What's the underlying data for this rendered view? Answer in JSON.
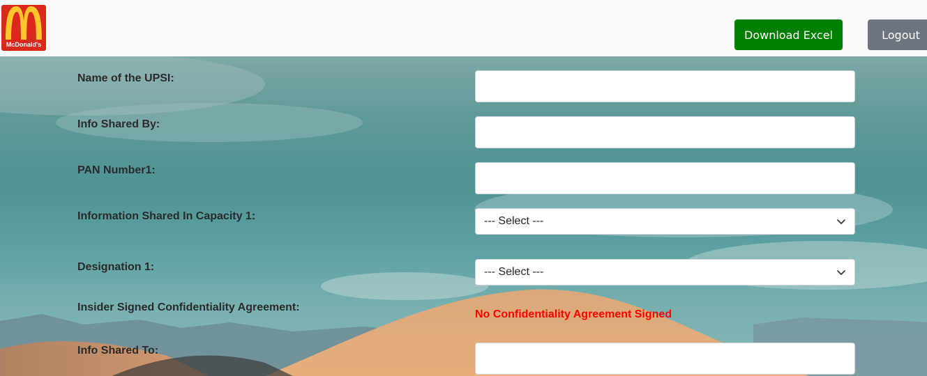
{
  "header": {
    "logo_text": "McDonald's",
    "download_label": "Download Excel",
    "logout_label": "Logout"
  },
  "form": {
    "upsi_name_label": "Name of the UPSI:",
    "upsi_name_value": "",
    "shared_by_label": "Info Shared By:",
    "shared_by_value": "",
    "pan_label": "PAN Number1:",
    "pan_value": "",
    "capacity_label": "Information Shared In Capacity 1:",
    "capacity_value": "--- Select ---",
    "designation_label": "Designation 1:",
    "designation_value": "--- Select ---",
    "agreement_label": "Insider Signed Confidentiality Agreement:",
    "agreement_status": "No Confidentiality Agreement Signed",
    "shared_to_label": "Info Shared To:",
    "shared_to_value": ""
  },
  "colors": {
    "download_button": "#008000",
    "logout_button": "#6c757d",
    "warning_text": "#ff0000",
    "logo_arches": "#ffc72c",
    "logo_red": "#da291c"
  },
  "icons": {
    "logo": "mcdonalds-logo",
    "select_chevron": "chevron-down-icon"
  }
}
